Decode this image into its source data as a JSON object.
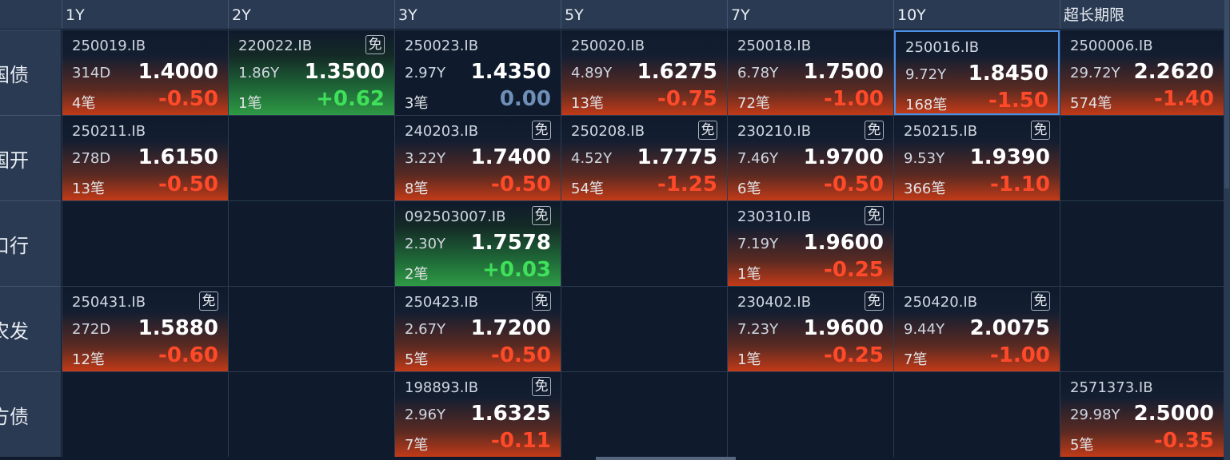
{
  "columns": [
    "1Y",
    "2Y",
    "3Y",
    "5Y",
    "7Y",
    "10Y",
    "超长期限"
  ],
  "rows": [
    {
      "label": "国债",
      "cells": [
        {
          "code": "250019.IB",
          "mian": "",
          "term": "314D",
          "yield": "1.4000",
          "count": "4笔",
          "change": "-0.50",
          "dir": "neg"
        },
        {
          "code": "220022.IB",
          "mian": "免",
          "term": "1.86Y",
          "yield": "1.3500",
          "count": "1笔",
          "change": "+0.62",
          "dir": "pos"
        },
        {
          "code": "250023.IB",
          "mian": "",
          "term": "2.97Y",
          "yield": "1.4350",
          "count": "3笔",
          "change": "0.00",
          "dir": "flat"
        },
        {
          "code": "250020.IB",
          "mian": "",
          "term": "4.89Y",
          "yield": "1.6275",
          "count": "13笔",
          "change": "-0.75",
          "dir": "neg"
        },
        {
          "code": "250018.IB",
          "mian": "",
          "term": "6.78Y",
          "yield": "1.7500",
          "count": "72笔",
          "change": "-1.00",
          "dir": "neg"
        },
        {
          "code": "250016.IB",
          "mian": "",
          "term": "9.72Y",
          "yield": "1.8450",
          "count": "168笔",
          "change": "-1.50",
          "dir": "neg",
          "selected": true
        },
        {
          "code": "2500006.IB",
          "mian": "",
          "term": "29.72Y",
          "yield": "2.2620",
          "count": "574笔",
          "change": "-1.40",
          "dir": "neg"
        }
      ]
    },
    {
      "label": "国开",
      "cells": [
        {
          "code": "250211.IB",
          "mian": "",
          "term": "278D",
          "yield": "1.6150",
          "count": "13笔",
          "change": "-0.50",
          "dir": "neg"
        },
        null,
        {
          "code": "240203.IB",
          "mian": "免",
          "term": "3.22Y",
          "yield": "1.7400",
          "count": "8笔",
          "change": "-0.50",
          "dir": "neg"
        },
        {
          "code": "250208.IB",
          "mian": "免",
          "term": "4.52Y",
          "yield": "1.7775",
          "count": "54笔",
          "change": "-1.25",
          "dir": "neg"
        },
        {
          "code": "230210.IB",
          "mian": "免",
          "term": "7.46Y",
          "yield": "1.9700",
          "count": "6笔",
          "change": "-0.50",
          "dir": "neg"
        },
        {
          "code": "250215.IB",
          "mian": "免",
          "term": "9.53Y",
          "yield": "1.9390",
          "count": "366笔",
          "change": "-1.10",
          "dir": "neg"
        },
        null
      ]
    },
    {
      "label": "口行",
      "cells": [
        null,
        null,
        {
          "code": "092503007.IB",
          "mian": "免",
          "term": "2.30Y",
          "yield": "1.7578",
          "count": "2笔",
          "change": "+0.03",
          "dir": "pos"
        },
        null,
        {
          "code": "230310.IB",
          "mian": "免",
          "term": "7.19Y",
          "yield": "1.9600",
          "count": "1笔",
          "change": "-0.25",
          "dir": "neg"
        },
        null,
        null
      ]
    },
    {
      "label": "农发",
      "cells": [
        {
          "code": "250431.IB",
          "mian": "免",
          "term": "272D",
          "yield": "1.5880",
          "count": "12笔",
          "change": "-0.60",
          "dir": "neg"
        },
        null,
        {
          "code": "250423.IB",
          "mian": "免",
          "term": "2.67Y",
          "yield": "1.7200",
          "count": "5笔",
          "change": "-0.50",
          "dir": "neg"
        },
        null,
        {
          "code": "230402.IB",
          "mian": "免",
          "term": "7.23Y",
          "yield": "1.9600",
          "count": "1笔",
          "change": "-0.25",
          "dir": "neg"
        },
        {
          "code": "250420.IB",
          "mian": "免",
          "term": "9.44Y",
          "yield": "2.0075",
          "count": "7笔",
          "change": "-1.00",
          "dir": "neg"
        },
        null
      ]
    },
    {
      "label": "地方债",
      "cells": [
        null,
        null,
        {
          "code": "198893.IB",
          "mian": "免",
          "term": "2.96Y",
          "yield": "1.6325",
          "count": "7笔",
          "change": "-0.11",
          "dir": "neg"
        },
        null,
        null,
        null,
        {
          "code": "2571373.IB",
          "mian": "",
          "term": "29.98Y",
          "yield": "2.5000",
          "count": "5笔",
          "change": "-0.35",
          "dir": "neg"
        }
      ]
    }
  ],
  "colors": {
    "negative": "#ff4a2a",
    "positive": "#3fe05a",
    "flat": "#6f8fb8",
    "selection": "#4a8fe6"
  }
}
